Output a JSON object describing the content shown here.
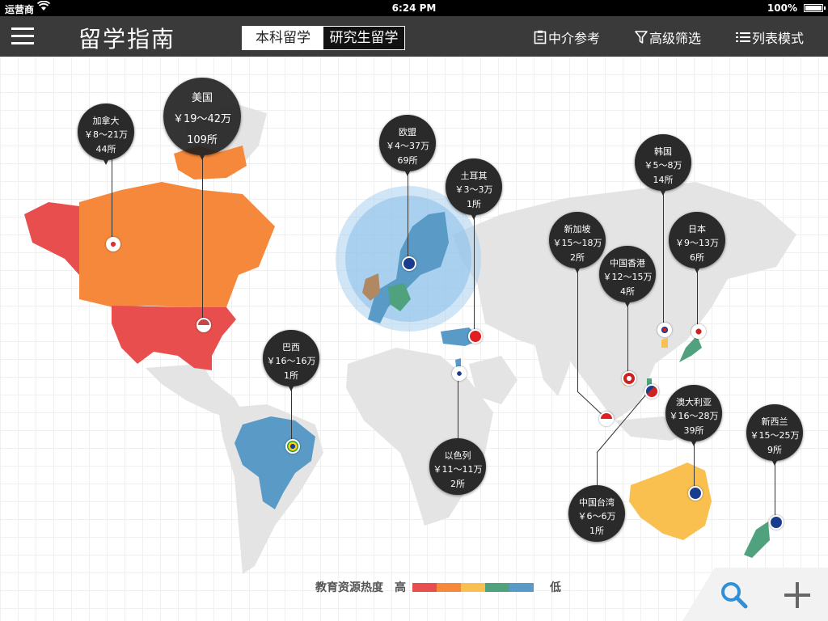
{
  "status": {
    "carrier": "运营商",
    "time": "6:24 PM",
    "battery": "100%"
  },
  "nav": {
    "title": "留学指南",
    "seg_undergrad": "本科留学",
    "seg_grad": "研究生留学",
    "agency": "中介参考",
    "filter": "高级筛选",
    "list_mode": "列表模式"
  },
  "pins": {
    "canada": {
      "name": "加拿大",
      "price": "￥8～21万",
      "count": "44所"
    },
    "usa": {
      "name": "美国",
      "price": "￥19～42万",
      "count": "109所"
    },
    "eu": {
      "name": "欧盟",
      "price": "￥4～37万",
      "count": "69所"
    },
    "turkey": {
      "name": "土耳其",
      "price": "￥3～3万",
      "count": "1所"
    },
    "brazil": {
      "name": "巴西",
      "price": "￥16～16万",
      "count": "1所"
    },
    "israel": {
      "name": "以色列",
      "price": "￥11～11万",
      "count": "2所"
    },
    "singapore": {
      "name": "新加坡",
      "price": "￥15～18万",
      "count": "2所"
    },
    "hongkong": {
      "name": "中国香港",
      "price": "￥12～15万",
      "count": "4所"
    },
    "korea": {
      "name": "韩国",
      "price": "￥5～8万",
      "count": "14所"
    },
    "japan": {
      "name": "日本",
      "price": "￥9～13万",
      "count": "6所"
    },
    "australia": {
      "name": "澳大利亚",
      "price": "￥16～28万",
      "count": "39所"
    },
    "newzealand": {
      "name": "新西兰",
      "price": "￥15～25万",
      "count": "9所"
    },
    "taiwan": {
      "name": "中国台湾",
      "price": "￥6～6万",
      "count": "1所"
    }
  },
  "legend": {
    "label": "教育资源热度",
    "high": "高",
    "low": "低",
    "colors": [
      "#e84e4e",
      "#f5883a",
      "#f9c04f",
      "#4fa27d",
      "#5a9ac6"
    ]
  },
  "colors": {
    "nav_bg": "#3a3a3a",
    "land": "#e4e4e4",
    "hot1": "#e84e4e",
    "hot2": "#f5883a",
    "hot3": "#f9c04f",
    "hot4": "#4fa27d",
    "hot5": "#5a9ac6",
    "accent": "#2f8fd8"
  },
  "icons": {
    "zoom": "search-icon",
    "add": "plus-icon",
    "menu": "hamburger-icon"
  }
}
